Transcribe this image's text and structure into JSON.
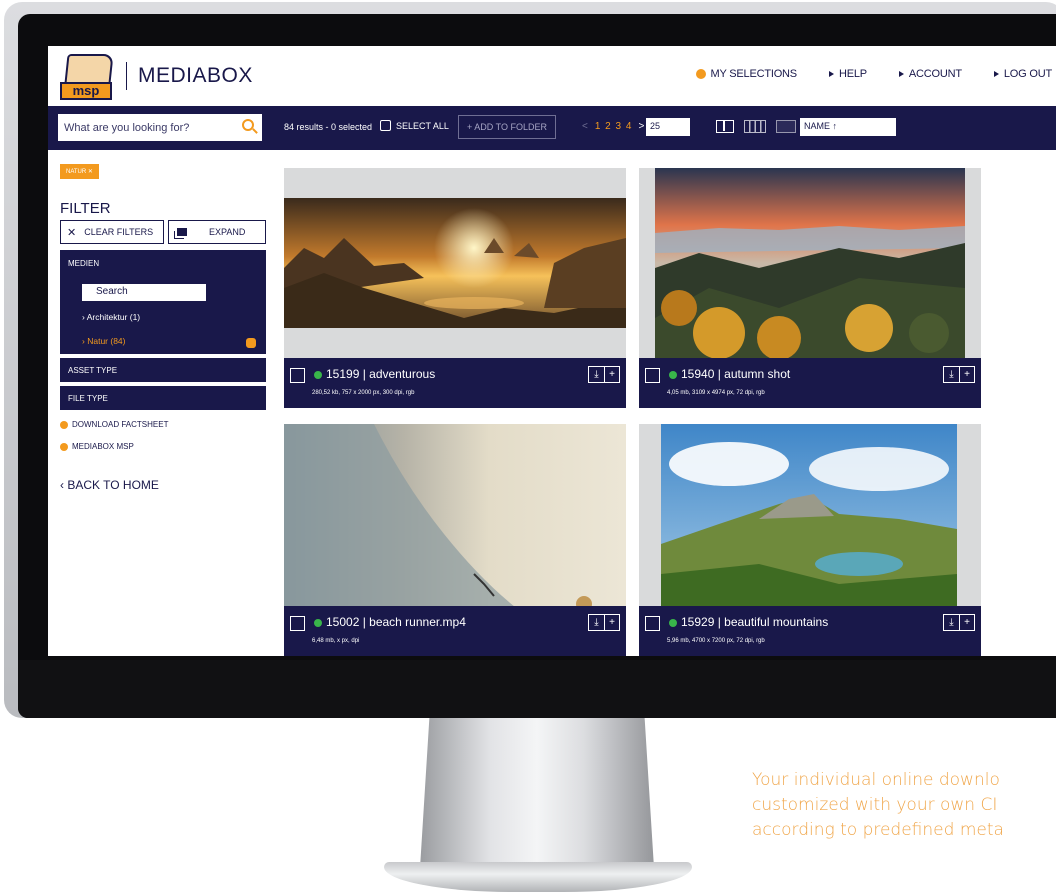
{
  "app": {
    "logo_text": "msp",
    "brand": "MEDIABOX"
  },
  "topnav": [
    {
      "label": "MY SELECTIONS",
      "icon": "orange-circle-icon"
    },
    {
      "label": "HELP",
      "icon": "triangle-right-icon"
    },
    {
      "label": "ACCOUNT",
      "icon": "triangle-right-icon"
    },
    {
      "label": "LOG OUT",
      "icon": "triangle-right-icon"
    }
  ],
  "toolbar": {
    "search_placeholder": "What are you looking for?",
    "results": "84 results - 0 selected",
    "select_all": "SELECT ALL",
    "add_to_folder": "+ ADD TO FOLDER",
    "pager_prev": "<",
    "pages": "1 2 3 4",
    "pager_next": ">",
    "per_page": "25",
    "sort": "NAME ↑"
  },
  "sidebar": {
    "active_tag": "NATUR ✕",
    "filter_title": "FILTER",
    "clear_filters": "CLEAR FILTERS",
    "expand": "EXPAND",
    "medien_title": "MEDIEN",
    "medien_search": "Search",
    "medien_items": [
      {
        "label": "Architektur (1)",
        "active": false
      },
      {
        "label": "Natur (84)",
        "active": true
      }
    ],
    "asset_type": "ASSET TYPE",
    "file_type": "FILE TYPE",
    "links": [
      "DOWNLOAD FACTSHEET",
      "MEDIABOX MSP"
    ],
    "back": "BACK TO HOME"
  },
  "assets": [
    {
      "id": "15199",
      "name": "adventurous",
      "title": "15199 | adventurous",
      "meta": "280,52 kb, 757 x 2000 px, 300 dpi, rgb",
      "status": "green"
    },
    {
      "id": "15940",
      "name": "autumn shot",
      "title": "15940 | autumn shot",
      "meta": "4,05 mb, 3109 x 4974 px, 72 dpi, rgb",
      "status": "green"
    },
    {
      "id": "15002",
      "name": "beach runner.mp4",
      "title": "15002 | beach runner.mp4",
      "meta": "6,48 mb, x px, dpi",
      "status": "green"
    },
    {
      "id": "15929",
      "name": "beautiful mountains",
      "title": "15929 | beautiful mountains",
      "meta": "5,96 mb, 4700 x 7200 px, 72 dpi, rgb",
      "status": "green"
    }
  ],
  "caption": {
    "line1": "Your individual online downlo",
    "line2": "customized with your own CI",
    "line3": "according to predefined meta"
  },
  "colors": {
    "navy": "#19184a",
    "orange": "#f39a1e",
    "status_green": "#39b54a"
  }
}
